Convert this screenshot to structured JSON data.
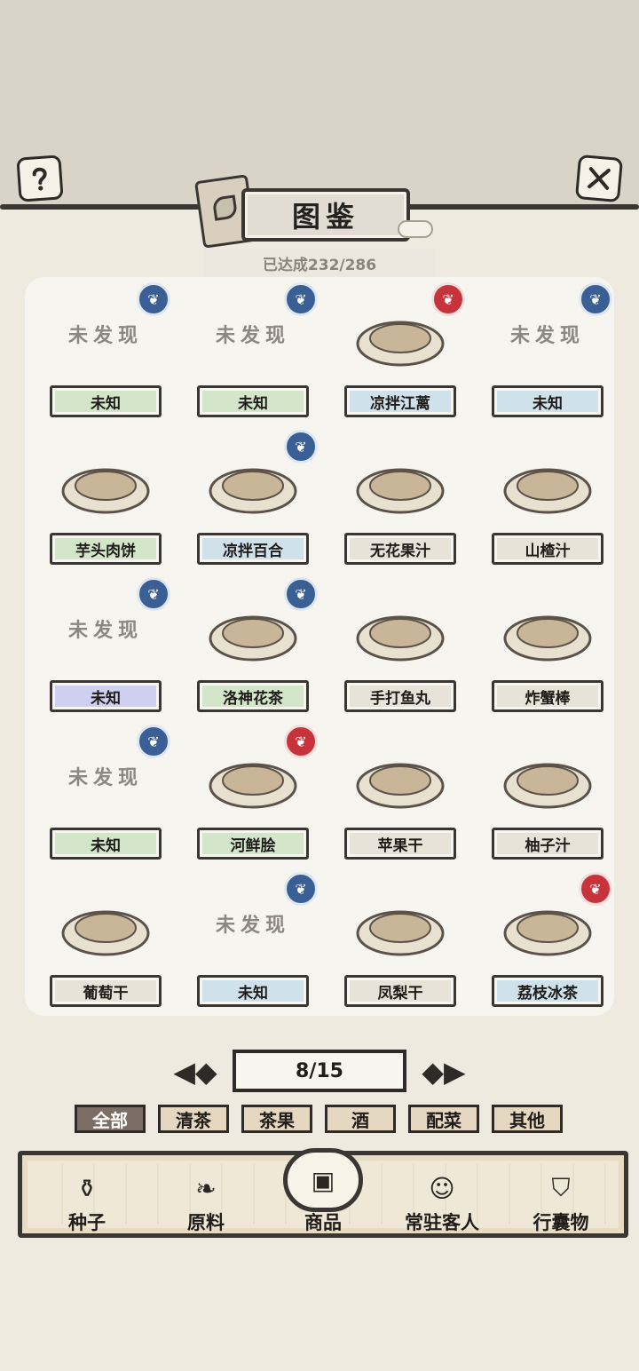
{
  "header": {
    "help_icon": "question-mark-icon",
    "close_icon": "close-x-icon",
    "title": "图鉴",
    "progress": "已达成232/286"
  },
  "items": [
    {
      "name": "未知",
      "thumb": "未发现",
      "label_color": "green",
      "badge": "blue"
    },
    {
      "name": "未知",
      "thumb": "未发现",
      "label_color": "green",
      "badge": "blue"
    },
    {
      "name": "凉拌江蓠",
      "thumb": "",
      "label_color": "blue",
      "badge": "red"
    },
    {
      "name": "未知",
      "thumb": "未发现",
      "label_color": "blue",
      "badge": "blue"
    },
    {
      "name": "芋头肉饼",
      "thumb": "",
      "label_color": "green",
      "badge": ""
    },
    {
      "name": "凉拌百合",
      "thumb": "",
      "label_color": "blue",
      "badge": "blue"
    },
    {
      "name": "无花果汁",
      "thumb": "",
      "label_color": "plain",
      "badge": ""
    },
    {
      "name": "山楂汁",
      "thumb": "",
      "label_color": "plain",
      "badge": ""
    },
    {
      "name": "未知",
      "thumb": "未发现",
      "label_color": "purple",
      "badge": "blue"
    },
    {
      "name": "洛神花茶",
      "thumb": "",
      "label_color": "green",
      "badge": "blue"
    },
    {
      "name": "手打鱼丸",
      "thumb": "",
      "label_color": "plain",
      "badge": ""
    },
    {
      "name": "炸蟹棒",
      "thumb": "",
      "label_color": "plain",
      "badge": ""
    },
    {
      "name": "未知",
      "thumb": "未发现",
      "label_color": "green",
      "badge": "blue"
    },
    {
      "name": "河鲜脍",
      "thumb": "",
      "label_color": "green",
      "badge": "red"
    },
    {
      "name": "苹果干",
      "thumb": "",
      "label_color": "plain",
      "badge": ""
    },
    {
      "name": "柚子汁",
      "thumb": "",
      "label_color": "plain",
      "badge": ""
    },
    {
      "name": "葡萄干",
      "thumb": "",
      "label_color": "plain",
      "badge": ""
    },
    {
      "name": "未知",
      "thumb": "未发现",
      "label_color": "blue",
      "badge": "blue"
    },
    {
      "name": "凤梨干",
      "thumb": "",
      "label_color": "plain",
      "badge": ""
    },
    {
      "name": "荔枝冰茶",
      "thumb": "",
      "label_color": "blue",
      "badge": "red"
    }
  ],
  "pager": {
    "page": "8/15",
    "prev_icon": "ornate-left-arrow-icon",
    "next_icon": "ornate-right-arrow-icon"
  },
  "filters": [
    {
      "label": "全部",
      "active": true
    },
    {
      "label": "清茶",
      "active": false
    },
    {
      "label": "茶果",
      "active": false
    },
    {
      "label": "酒",
      "active": false
    },
    {
      "label": "配菜",
      "active": false
    },
    {
      "label": "其他",
      "active": false
    }
  ],
  "nav": [
    {
      "label": "种子",
      "icon": "seed-jar-icon",
      "active": false
    },
    {
      "label": "原料",
      "icon": "tea-leaf-icon",
      "active": false
    },
    {
      "label": "商品",
      "icon": "goods-plate-icon",
      "active": true
    },
    {
      "label": "常驻客人",
      "icon": "guest-girl-icon",
      "active": false
    },
    {
      "label": "行囊物",
      "icon": "robe-icon",
      "active": false
    }
  ],
  "colors": {
    "label_green": "#d3e6c9",
    "label_blue": "#cfe1ea",
    "label_purple": "#cfd0ef",
    "label_plain": "#e8e3d8",
    "badge_blue": "#3a5f94",
    "badge_red": "#c7333a",
    "filter_active": "#7c6e65"
  }
}
